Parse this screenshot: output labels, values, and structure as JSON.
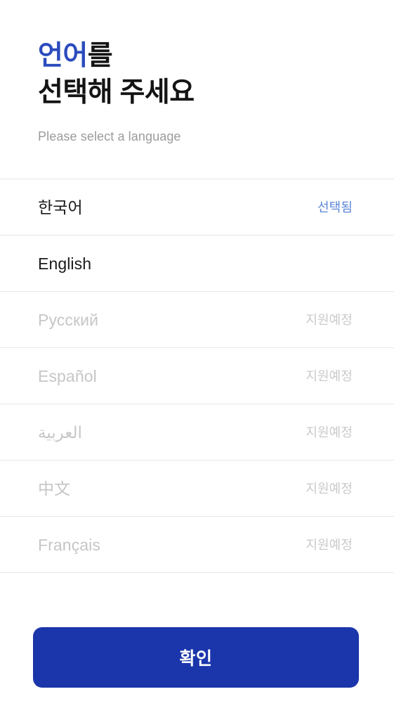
{
  "header": {
    "title_line1_accent": "언어",
    "title_line1_rest": "를",
    "title_line2": "선택해 주세요",
    "subtitle": "Please select a language"
  },
  "colors": {
    "accent_blue": "#2b4bbd",
    "button_blue": "#1b35ab",
    "selected_badge_blue": "#5b86d8",
    "disabled_grey": "#c6c6c6",
    "divider_grey": "#e7e7e7",
    "subtitle_grey": "#9b9b9b",
    "text_black": "#1a1a1a"
  },
  "languages": [
    {
      "name": "한국어",
      "badge": "선택됨",
      "state": "selected"
    },
    {
      "name": "English",
      "badge": "",
      "state": "available"
    },
    {
      "name": "Русский",
      "badge": "지원예정",
      "state": "disabled"
    },
    {
      "name": "Español",
      "badge": "지원예정",
      "state": "disabled"
    },
    {
      "name": "العربية",
      "badge": "지원예정",
      "state": "disabled"
    },
    {
      "name": "中文",
      "badge": "지원예정",
      "state": "disabled"
    },
    {
      "name": "Français",
      "badge": "지원예정",
      "state": "disabled"
    }
  ],
  "footer": {
    "confirm_label": "확인"
  }
}
